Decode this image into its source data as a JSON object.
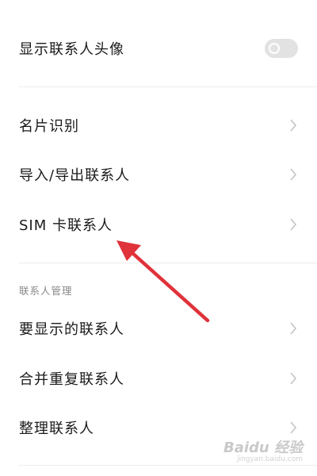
{
  "settings": {
    "show_avatar": {
      "label": "显示联系人头像",
      "enabled": false
    },
    "items_group1": [
      {
        "label": "名片识别"
      },
      {
        "label": "导入/导出联系人"
      },
      {
        "label": "SIM 卡联系人"
      }
    ],
    "section_title": "联系人管理",
    "items_group2": [
      {
        "label": "要显示的联系人"
      },
      {
        "label": "合并重复联系人"
      },
      {
        "label": "整理联系人"
      }
    ]
  },
  "annotation": {
    "color": "#e0323a",
    "icon": "red-arrow-pointer"
  },
  "watermark": {
    "brand": "Baidu 经验",
    "url": "jingyan.baidu.com"
  }
}
